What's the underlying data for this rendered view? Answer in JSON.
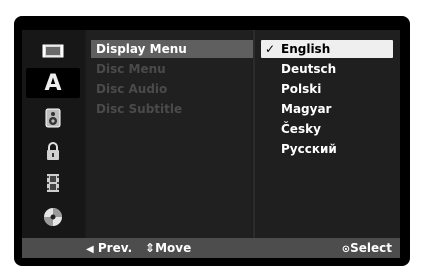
{
  "sidebar": {
    "items": [
      {
        "icon": "film-frame-icon"
      },
      {
        "icon": "letter-a-icon",
        "glyph": "A"
      },
      {
        "icon": "speaker-icon"
      },
      {
        "icon": "padlock-icon"
      },
      {
        "icon": "film-strip-icon"
      },
      {
        "icon": "disc-icon"
      }
    ]
  },
  "menu": {
    "items": [
      {
        "label": "Display Menu"
      },
      {
        "label": "Disc Menu"
      },
      {
        "label": "Disc Audio"
      },
      {
        "label": "Disc Subtitle"
      }
    ]
  },
  "options": {
    "items": [
      {
        "label": "English",
        "check": "✓"
      },
      {
        "label": "Deutsch"
      },
      {
        "label": "Polski"
      },
      {
        "label": "Magyar"
      },
      {
        "label": "Česky"
      },
      {
        "label": "Русский"
      }
    ]
  },
  "footer": {
    "prev_glyph": "◀",
    "prev_label": "Prev.",
    "move_glyph": "⇕",
    "move_label": "Move",
    "select_glyph": "⊙",
    "select_label": "Select"
  },
  "colors": {
    "background": "#000000",
    "panel": "#1d1d1d",
    "menu_highlight": "#5f5f5f",
    "option_highlight": "#efefef",
    "footer": "#4d4d4d",
    "disabled_text": "#4a4a4a"
  }
}
